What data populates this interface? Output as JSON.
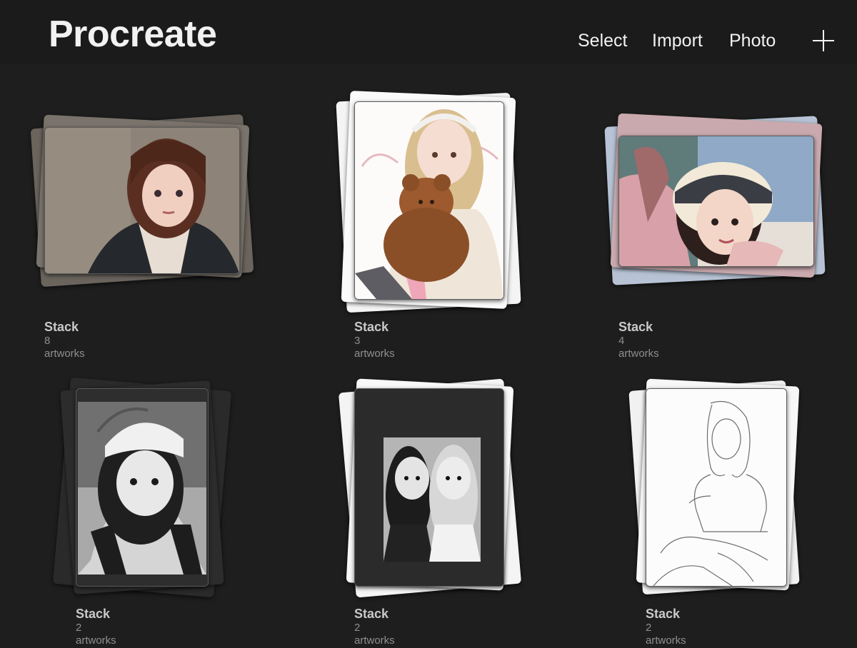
{
  "header": {
    "title": "Procreate",
    "select_label": "Select",
    "import_label": "Import",
    "photo_label": "Photo",
    "add_icon": "plus-icon"
  },
  "stacks": [
    {
      "name": "Stack",
      "count": "8 artworks"
    },
    {
      "name": "Stack",
      "count": "3 artworks"
    },
    {
      "name": "Stack",
      "count": "4 artworks"
    },
    {
      "name": "Stack",
      "count": "2 artworks"
    },
    {
      "name": "Stack",
      "count": "2 artworks"
    },
    {
      "name": "Stack",
      "count": "2 artworks"
    }
  ],
  "colors": {
    "background": "#1e1e1e",
    "header": "#1b1b1b",
    "text": "#f2f2f2",
    "stack_name": "#c9c9c9",
    "stack_count": "#8f8f8f"
  }
}
